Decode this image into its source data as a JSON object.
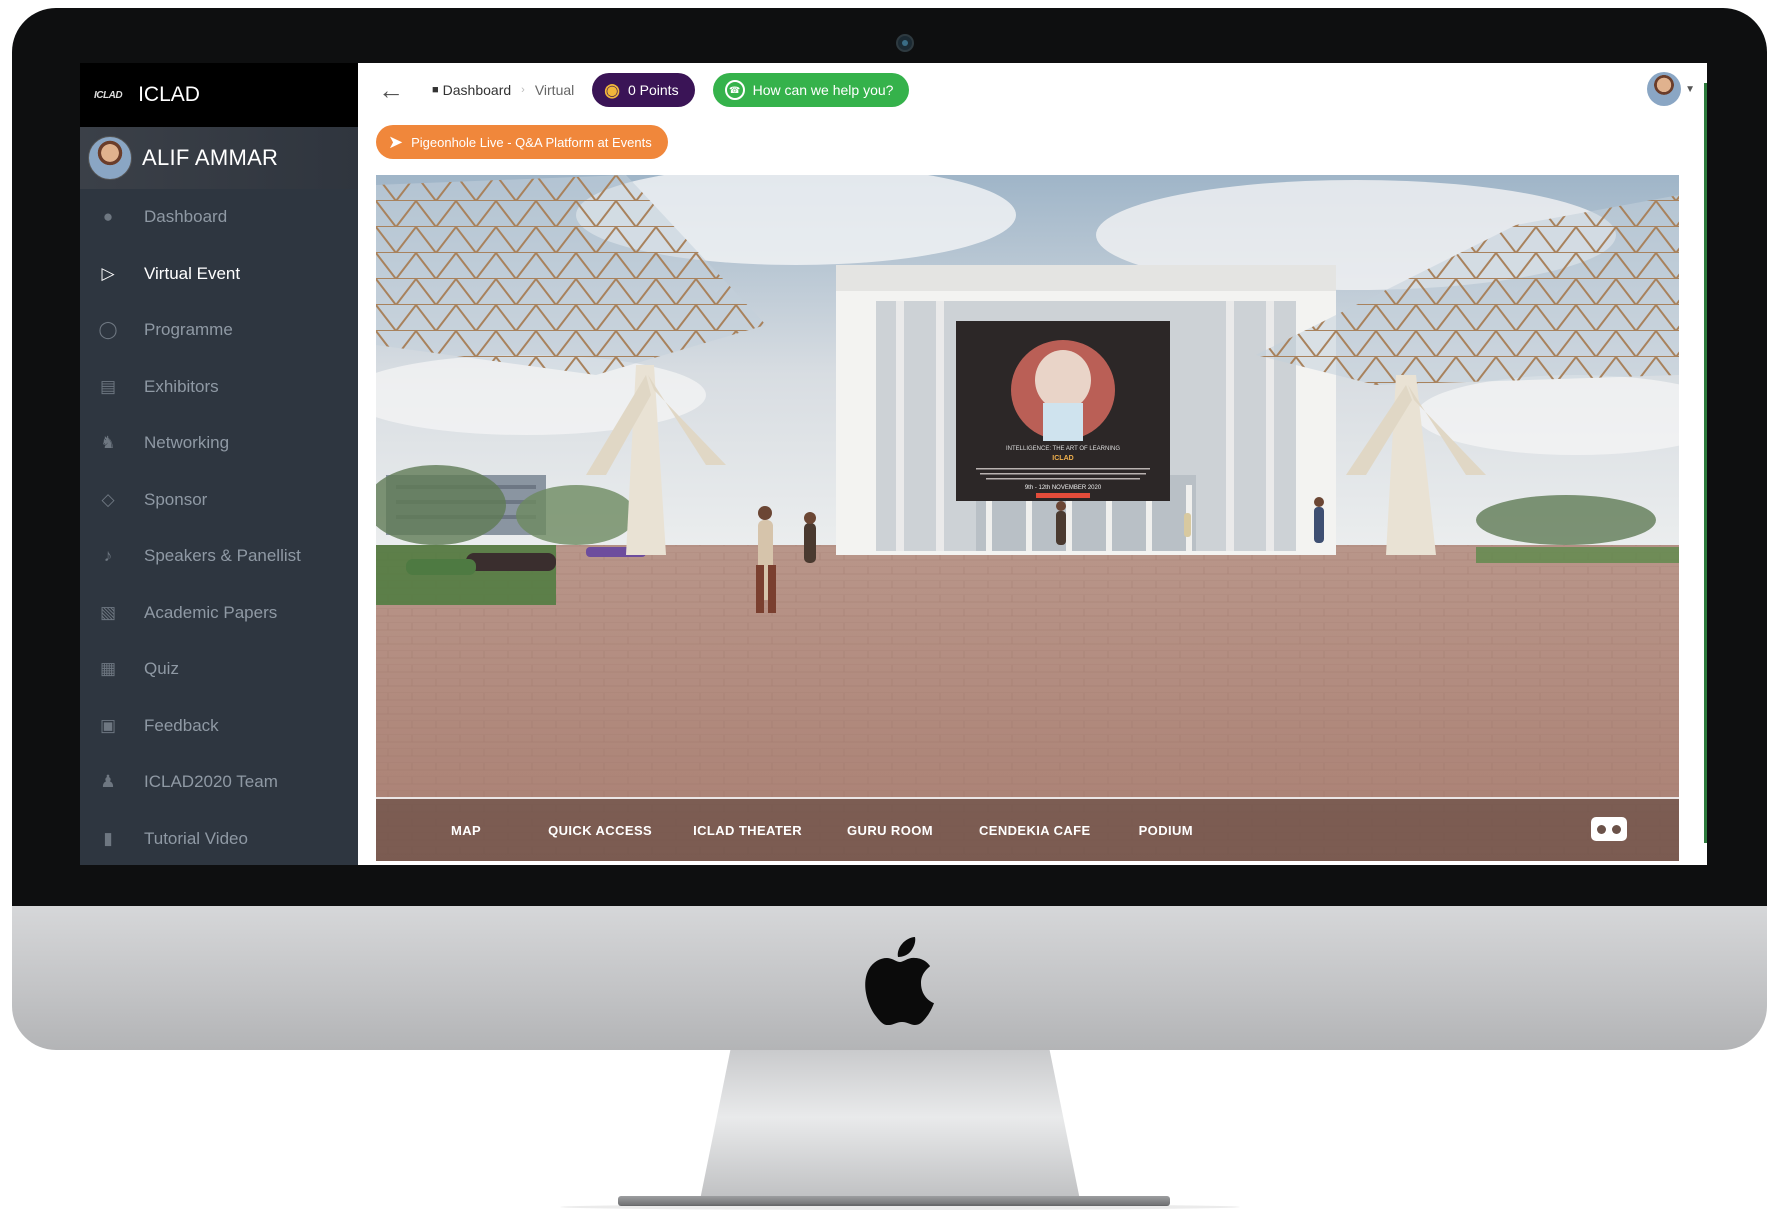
{
  "app": {
    "brand_logo": "ICLAD",
    "brand_name": "ICLAD",
    "user_name": "ALIF AMMAR"
  },
  "sidebar": {
    "items": [
      {
        "label": "Dashboard",
        "icon": "robot-icon",
        "active": false
      },
      {
        "label": "Virtual Event",
        "icon": "play-icon",
        "active": true
      },
      {
        "label": "Programme",
        "icon": "clock-icon",
        "active": false
      },
      {
        "label": "Exhibitors",
        "icon": "store-icon",
        "active": false
      },
      {
        "label": "Networking",
        "icon": "users-icon",
        "active": false
      },
      {
        "label": "Sponsor",
        "icon": "gem-icon",
        "active": false
      },
      {
        "label": "Speakers & Panellist",
        "icon": "microphone-icon",
        "active": false
      },
      {
        "label": "Academic Papers",
        "icon": "scroll-icon",
        "active": false
      },
      {
        "label": "Quiz",
        "icon": "quiz-icon",
        "active": false
      },
      {
        "label": "Feedback",
        "icon": "book-icon",
        "active": false
      },
      {
        "label": "ICLAD2020 Team",
        "icon": "team-icon",
        "active": false
      },
      {
        "label": "Tutorial Video",
        "icon": "video-icon",
        "active": false
      }
    ]
  },
  "topbar": {
    "breadcrumb_home": "Dashboard",
    "breadcrumb_current": "Virtual",
    "points_label": "0 Points",
    "help_label": "How can we help you?"
  },
  "banner": {
    "pigeonhole_label": "Pigeonhole Live - Q&A Platform at Events"
  },
  "scene": {
    "poster_title": "INTELLIGENCE: THE ART OF LEARNING",
    "poster_logo": "ICLAD",
    "poster_dates": "9th - 12th NOVEMBER 2020",
    "nav": [
      "MAP",
      "QUICK ACCESS",
      "ICLAD THEATER",
      "GURU ROOM",
      "CENDEKIA CAFE",
      "PODIUM"
    ]
  },
  "colors": {
    "sidebar_bg": "#2e3640",
    "points_bg": "#3a1456",
    "help_bg": "#35b24b",
    "pigeonhole_bg": "#f0873b"
  }
}
